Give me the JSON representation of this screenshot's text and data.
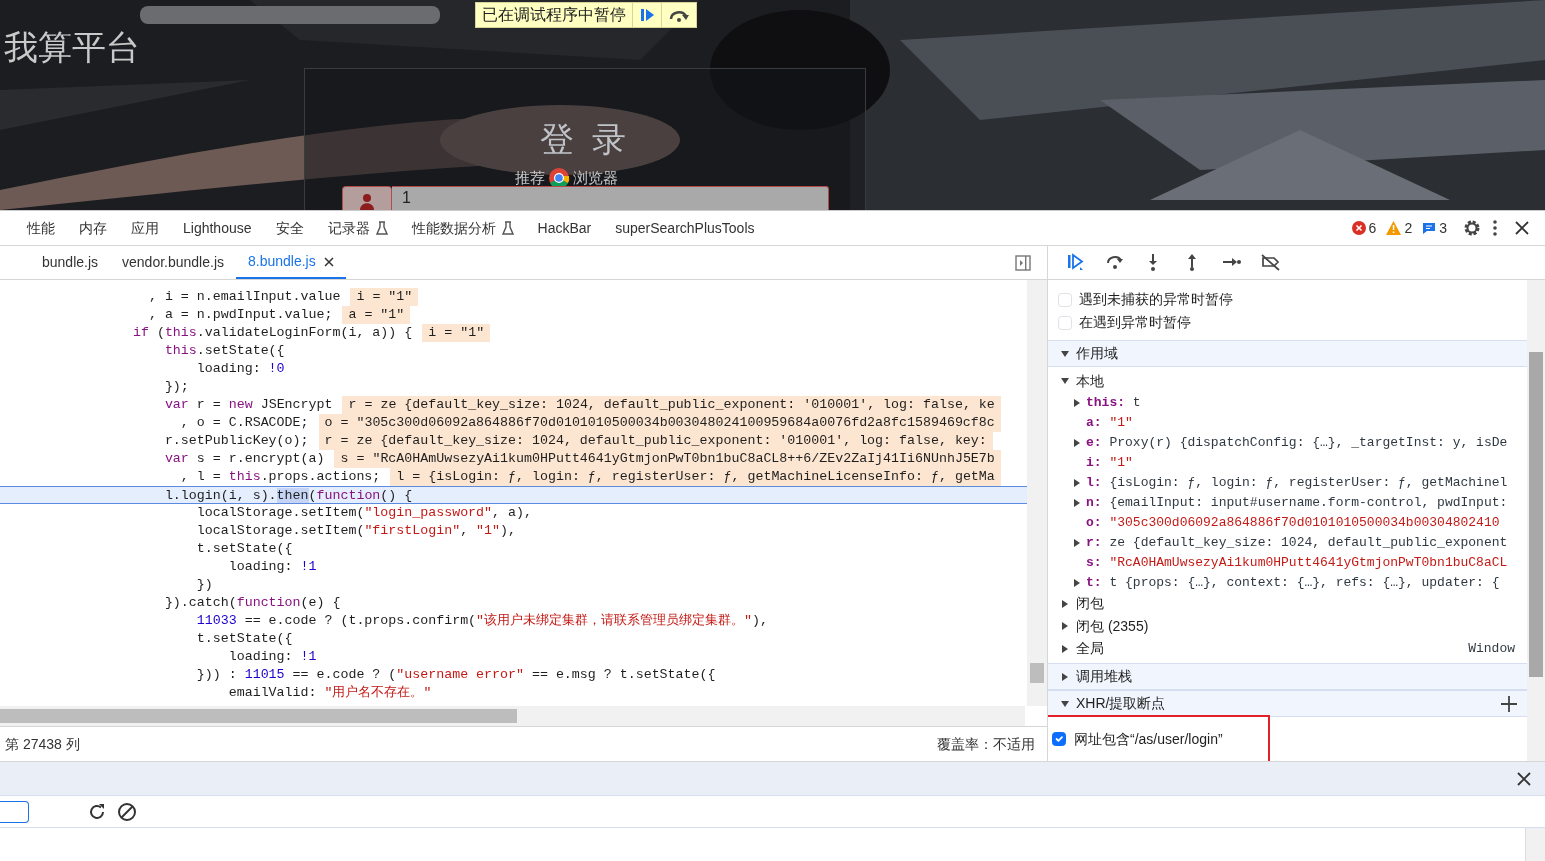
{
  "page": {
    "site_title": "我算平台",
    "login_title": "登 录",
    "recommend_prefix": "推荐",
    "recommend_suffix": "浏览器",
    "username_value": "1"
  },
  "paused_banner": {
    "text": "已在调试程序中暂停"
  },
  "devtools_tabs": [
    {
      "label": "性能",
      "selected": false,
      "experimental": false
    },
    {
      "label": "内存",
      "selected": false,
      "experimental": false
    },
    {
      "label": "应用",
      "selected": false,
      "experimental": false
    },
    {
      "label": "Lighthouse",
      "selected": false,
      "experimental": false
    },
    {
      "label": "安全",
      "selected": false,
      "experimental": false
    },
    {
      "label": "记录器",
      "selected": false,
      "experimental": true
    },
    {
      "label": "性能数据分析",
      "selected": false,
      "experimental": true
    },
    {
      "label": "HackBar",
      "selected": false,
      "experimental": false
    },
    {
      "label": "superSearchPlusTools",
      "selected": false,
      "experimental": false
    }
  ],
  "issue_counts": {
    "errors": "6",
    "warnings": "2",
    "messages": "3"
  },
  "file_tabs": [
    {
      "label": "bundle.js",
      "selected": false
    },
    {
      "label": "vendor.bundle.js",
      "selected": false
    },
    {
      "label": "8.bundle.js",
      "selected": true
    }
  ],
  "code_lines": [
    {
      "current": false,
      "segments": [
        {
          "kind": "txt",
          "text": "    , i = n.emailInput.value"
        }
      ],
      "inline_value": "i = \"1\""
    },
    {
      "current": false,
      "segments": [
        {
          "kind": "txt",
          "text": "    , a = n.pwdInput.value;"
        }
      ],
      "inline_value": "a = \"1\""
    },
    {
      "current": false,
      "segments": [
        {
          "kind": "kw",
          "text": "  if"
        },
        {
          "kind": "txt",
          "text": " ("
        },
        {
          "kind": "kw",
          "text": "this"
        },
        {
          "kind": "txt",
          "text": ".validateLoginForm(i, a)) {"
        }
      ],
      "inline_value": "i = \"1\""
    },
    {
      "current": false,
      "segments": [
        {
          "kind": "kw",
          "text": "      this"
        },
        {
          "kind": "txt",
          "text": ".setState({"
        }
      ]
    },
    {
      "current": false,
      "segments": [
        {
          "kind": "txt",
          "text": "          loading: "
        },
        {
          "kind": "num",
          "text": "!0"
        }
      ]
    },
    {
      "current": false,
      "segments": [
        {
          "kind": "txt",
          "text": "      });"
        }
      ]
    },
    {
      "current": false,
      "segments": [
        {
          "kind": "kw",
          "text": "      var"
        },
        {
          "kind": "txt",
          "text": " r = "
        },
        {
          "kind": "kw",
          "text": "new"
        },
        {
          "kind": "txt",
          "text": " JSEncrypt"
        }
      ],
      "inline_value": "r = ze {default_key_size: 1024, default_public_exponent: '010001', log: false, ke"
    },
    {
      "current": false,
      "segments": [
        {
          "kind": "txt",
          "text": "        , o = C.RSACODE;"
        }
      ],
      "inline_value": "o = \"305c300d06092a864886f70d0101010500034b003048024100959684a0076fd2a8fc1589469cf8c"
    },
    {
      "current": false,
      "segments": [
        {
          "kind": "txt",
          "text": "      r.setPublicKey(o);"
        }
      ],
      "inline_value": "r = ze {default_key_size: 1024, default_public_exponent: '010001', log: false, key:"
    },
    {
      "current": false,
      "segments": [
        {
          "kind": "kw",
          "text": "      var"
        },
        {
          "kind": "txt",
          "text": " s = r.encrypt(a)"
        }
      ],
      "inline_value": "s = \"RcA0HAmUwsezyAi1kum0HPutt4641yGtmjonPwT0bn1buC8aCL8++6/ZEv2ZaIj41Ii6NUnhJ5E7b"
    },
    {
      "current": false,
      "segments": [
        {
          "kind": "txt",
          "text": "        , l = "
        },
        {
          "kind": "kw",
          "text": "this"
        },
        {
          "kind": "txt",
          "text": ".props.actions;"
        }
      ],
      "inline_value": "l = {isLogin: ƒ, login: ƒ, registerUser: ƒ, getMachineLicenseInfo: ƒ, getMa"
    },
    {
      "current": true,
      "segments": [
        {
          "kind": "txt",
          "text": "      l.login(i, s)."
        },
        {
          "kind": "match",
          "text": "then"
        },
        {
          "kind": "txt",
          "text": "("
        },
        {
          "kind": "kw",
          "text": "function"
        },
        {
          "kind": "txt",
          "text": "() {"
        }
      ]
    },
    {
      "current": false,
      "segments": [
        {
          "kind": "txt",
          "text": "          localStorage.setItem("
        },
        {
          "kind": "str",
          "text": "\"login_password\""
        },
        {
          "kind": "txt",
          "text": ", a),"
        }
      ]
    },
    {
      "current": false,
      "segments": [
        {
          "kind": "txt",
          "text": "          localStorage.setItem("
        },
        {
          "kind": "str",
          "text": "\"firstLogin\""
        },
        {
          "kind": "txt",
          "text": ", "
        },
        {
          "kind": "str",
          "text": "\"1\""
        },
        {
          "kind": "txt",
          "text": "),"
        }
      ]
    },
    {
      "current": false,
      "segments": [
        {
          "kind": "txt",
          "text": "          t.setState({"
        }
      ]
    },
    {
      "current": false,
      "segments": [
        {
          "kind": "txt",
          "text": "              loading: "
        },
        {
          "kind": "num",
          "text": "!1"
        }
      ]
    },
    {
      "current": false,
      "segments": [
        {
          "kind": "txt",
          "text": "          })"
        }
      ]
    },
    {
      "current": false,
      "segments": [
        {
          "kind": "txt",
          "text": "      }).catch("
        },
        {
          "kind": "kw",
          "text": "function"
        },
        {
          "kind": "txt",
          "text": "(e) {"
        }
      ]
    },
    {
      "current": false,
      "segments": [
        {
          "kind": "num",
          "text": "          11033"
        },
        {
          "kind": "txt",
          "text": " == e.code ? (t.props.confirm("
        },
        {
          "kind": "str",
          "text": "\"该用户未绑定集群，请联系管理员绑定集群。\""
        },
        {
          "kind": "txt",
          "text": "),"
        }
      ]
    },
    {
      "current": false,
      "segments": [
        {
          "kind": "txt",
          "text": "          t.setState({"
        }
      ]
    },
    {
      "current": false,
      "segments": [
        {
          "kind": "txt",
          "text": "              loading: "
        },
        {
          "kind": "num",
          "text": "!1"
        }
      ]
    },
    {
      "current": false,
      "segments": [
        {
          "kind": "txt",
          "text": "          })) : "
        },
        {
          "kind": "num",
          "text": "11015"
        },
        {
          "kind": "txt",
          "text": " == e.code ? ("
        },
        {
          "kind": "str",
          "text": "\"username error\""
        },
        {
          "kind": "txt",
          "text": " == e.msg ? t.setState({"
        }
      ]
    },
    {
      "current": false,
      "segments": [
        {
          "kind": "txt",
          "text": "              emailValid: "
        },
        {
          "kind": "str",
          "text": "\"用户名不存在。\""
        }
      ]
    }
  ],
  "status_bar": {
    "position": "第 27438 列",
    "coverage": "覆盖率：不适用"
  },
  "pause_options": [
    {
      "label": "遇到未捕获的异常时暂停",
      "checked": false
    },
    {
      "label": "在遇到异常时暂停",
      "checked": false
    }
  ],
  "scope": {
    "label": "作用域",
    "expanded": true,
    "sections": [
      {
        "label": "本地",
        "expanded": true,
        "children": [
          {
            "name": "this:",
            "kind": "object",
            "value": "t"
          },
          {
            "name": "a:",
            "kind": "string",
            "value": "\"1\""
          },
          {
            "name": "e:",
            "kind": "object",
            "value": "Proxy(r) {dispatchConfig: {…}, _targetInst: y, isDe"
          },
          {
            "name": "i:",
            "kind": "string",
            "value": "\"1\""
          },
          {
            "name": "l:",
            "kind": "object",
            "value": "{isLogin: ƒ, login: ƒ, registerUser: ƒ, getMachinel"
          },
          {
            "name": "n:",
            "kind": "object",
            "value": "{emailInput: input#username.form-control, pwdInput:"
          },
          {
            "name": "o:",
            "kind": "string",
            "value": "\"305c300d06092a864886f70d0101010500034b00304802410"
          },
          {
            "name": "r:",
            "kind": "object",
            "value": "ze {default_key_size: 1024, default_public_exponent"
          },
          {
            "name": "s:",
            "kind": "string",
            "value": "\"RcA0HAmUwsezyAi1kum0HPutt4641yGtmjonPwT0bn1buC8aCL"
          },
          {
            "name": "t:",
            "kind": "object",
            "value": "t {props: {…}, context: {…}, refs: {…}, updater: {"
          }
        ]
      },
      {
        "label": "闭包",
        "expanded": false
      },
      {
        "label": "闭包 (2355)",
        "expanded": false
      },
      {
        "label": "全局",
        "expanded": false,
        "value": "Window"
      }
    ]
  },
  "call_stack": {
    "label": "调用堆栈",
    "expanded": false
  },
  "xhr_breakpoints": {
    "label": "XHR/提取断点",
    "expanded": true,
    "items": [
      {
        "label": "网址包含“/as/user/login”",
        "checked": true,
        "highlighted": true
      }
    ]
  }
}
